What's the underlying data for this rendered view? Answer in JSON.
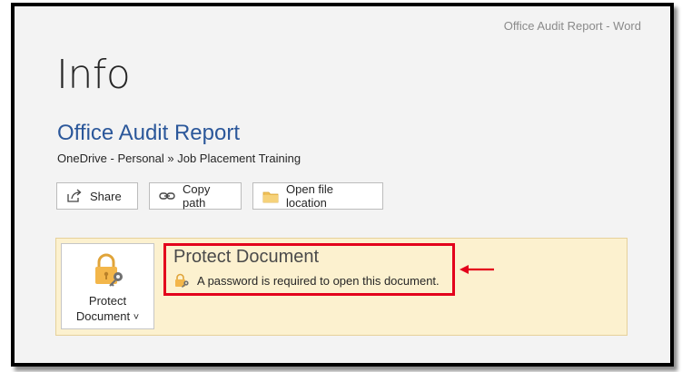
{
  "window": {
    "title": "Office Audit Report  -  Word"
  },
  "page": {
    "title": "Info"
  },
  "document": {
    "title": "Office Audit Report",
    "location": "OneDrive - Personal » Job Placement Training"
  },
  "actions": {
    "share_label": "Share",
    "copy_path_label": "Copy path",
    "open_location_label": "Open file location"
  },
  "protect": {
    "button_line1": "Protect",
    "button_line2": "Document",
    "chevron": "˅",
    "heading": "Protect Document",
    "description": "A password is required to open this document."
  },
  "colors": {
    "accent": "#2b579a",
    "panel_bg": "#fcf1cf",
    "annotation_red": "#e3001b"
  },
  "icons": [
    "share-icon",
    "link-icon",
    "folder-icon",
    "lock-key-icon",
    "arrow-left-icon"
  ]
}
